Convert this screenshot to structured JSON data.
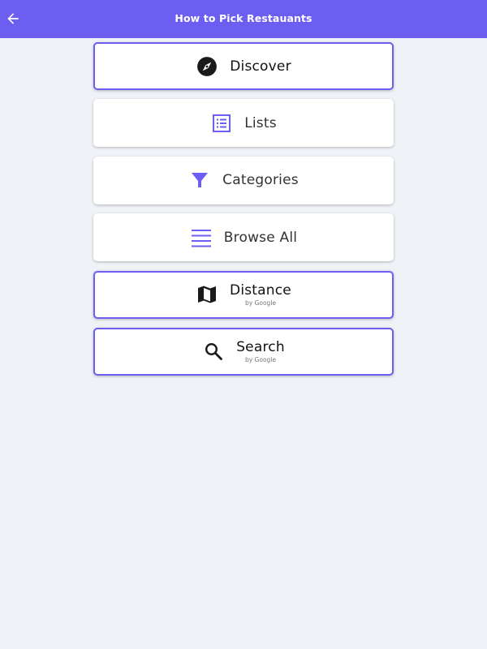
{
  "colors": {
    "accent": "#6c5ef0",
    "background": "#eff2f7",
    "icon_dark": "#1a1a1a"
  },
  "app_bar": {
    "title": "How to Pick Restauants",
    "back_icon": "arrow-back-icon"
  },
  "menu": [
    {
      "label": "Discover",
      "sub": "",
      "icon": "compass-icon",
      "outlined": true
    },
    {
      "label": "Lists",
      "sub": "",
      "icon": "list-icon",
      "outlined": false
    },
    {
      "label": "Categories",
      "sub": "",
      "icon": "filter-icon",
      "outlined": false
    },
    {
      "label": "Browse All",
      "sub": "",
      "icon": "menu-icon",
      "outlined": false
    },
    {
      "label": "Distance",
      "sub": "by Google",
      "icon": "map-icon",
      "outlined": true
    },
    {
      "label": "Search",
      "sub": "by Google",
      "icon": "search-icon",
      "outlined": true
    }
  ]
}
